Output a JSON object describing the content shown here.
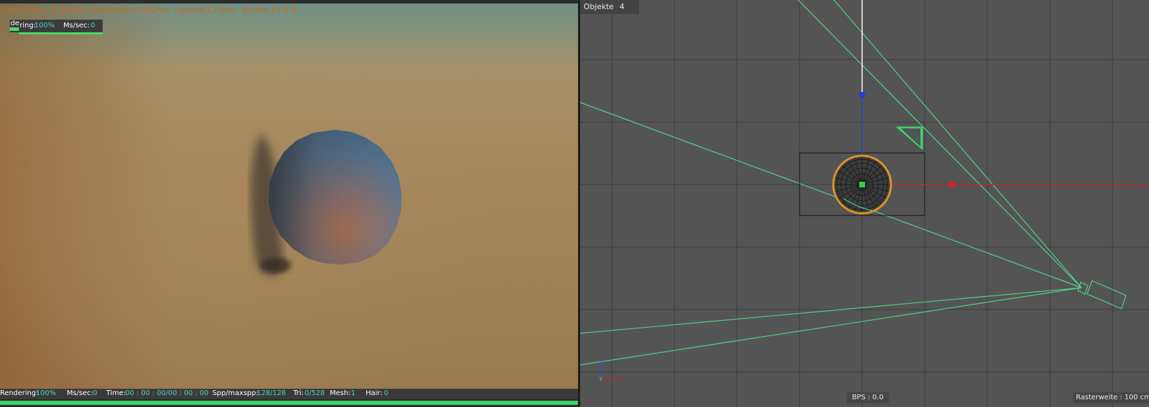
{
  "render_view": {
    "stats_line": "Check:0ms. 0.002ms. MeshGen:0.002ms. Update[C]:0ms. Nodes:16  0 0",
    "mini_overlay": {
      "prefix": "de",
      "rendering_label": "ring:",
      "rendering_value": "100%",
      "ms_label": "Ms/sec:",
      "ms_value": "0"
    },
    "status": {
      "rendering_label": "Rendering:",
      "rendering_value": "100%",
      "ms_label": "Ms/sec:",
      "ms_value": "0",
      "time_label": "Time:",
      "time_value": "00 : 00 : 00/00 : 00 : 00",
      "spp_label": "Spp/maxspp:",
      "spp_value": "128/128",
      "tri_label": "Tri:",
      "tri_value": "0/528",
      "mesh_label": "Mesh:",
      "mesh_value": "1",
      "hair_label": "Hair:",
      "hair_value": "0"
    },
    "progress": 1.0
  },
  "viewport": {
    "objects_label": "Objekte",
    "objects_count": "4",
    "bps": "BPS : 0.0",
    "grid_spacing": "Rasterweite : 100 cm",
    "axis_y_label": "Y",
    "axis_x_label": "X",
    "colors": {
      "background": "#545454",
      "grid": "#3c3c3c",
      "camera_lines": "#50d088",
      "x_axis": "#d42020",
      "y_axis": "#2a3ae0",
      "sphere_outline": "#e0902a"
    }
  },
  "colors": {
    "accent_teal": "#4ed2c2",
    "progress_green": "#3fd46a",
    "stats_orange": "#c8681c"
  }
}
